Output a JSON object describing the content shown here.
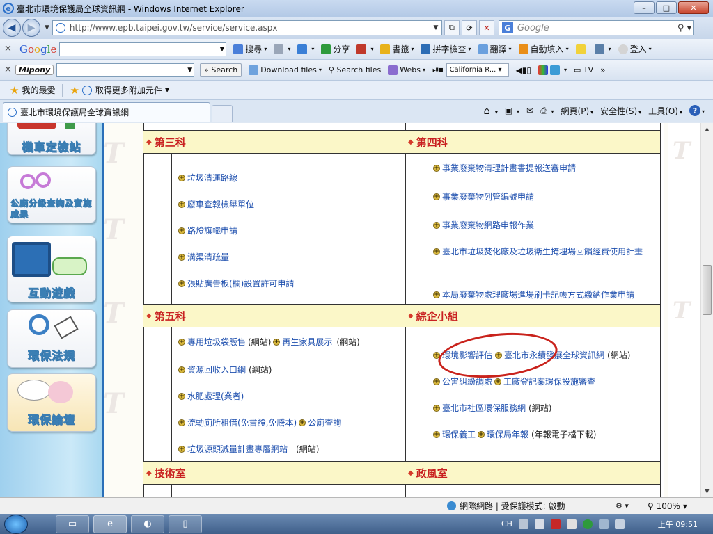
{
  "window": {
    "title": "臺北市環境保護局全球資訊網 - Windows Internet Explorer",
    "min": "–",
    "max": "□",
    "close": "✕"
  },
  "address": {
    "url": "http://www.epb.taipei.gov.tw/service/service.aspx",
    "search_placeholder": "Google"
  },
  "google_toolbar": {
    "logo": [
      "G",
      "o",
      "o",
      "g",
      "l",
      "e"
    ],
    "items": [
      "搜尋",
      "分享",
      "書籤",
      "拼字檢查",
      "翻譯",
      "自動填入",
      "登入"
    ]
  },
  "mipony_toolbar": {
    "logo": "Mipony",
    "search_btn": "Search",
    "download": "Download files",
    "search_files": "Search files",
    "webs": "Webs",
    "radio": "California R...",
    "tv": "TV"
  },
  "favorites": {
    "label": "我的最愛",
    "addons": "取得更多附加元件"
  },
  "tab": {
    "label": "臺北市環境保護局全球資訊網"
  },
  "commandbar": {
    "page": "網頁(P)",
    "safety": "安全性(S)",
    "tools": "工具(O)"
  },
  "leftnav": {
    "items": [
      "機車定檢站",
      "公廁分級查詢及實施成果",
      "互動遊戲",
      "環保法規",
      "環保論壇"
    ]
  },
  "sections": {
    "s3": {
      "title": "第三科",
      "items": [
        "垃圾清運路線",
        "廢車查報檢舉單位",
        "路燈旗幟申請",
        "溝渠清疏量",
        "張貼廣告板(欄)設置許可申請"
      ]
    },
    "s4": {
      "title": "第四科",
      "items": [
        "事業廢棄物清理計畫書提報送審申請",
        "事業廢棄物列管編號申請",
        "事業廢棄物網路申報作業",
        "臺北市垃圾焚化廠及垃圾衛生掩埋場回饋經費使用計畫",
        "本局廢棄物處理廠場進場刷卡記帳方式繳納作業申請"
      ]
    },
    "s5": {
      "title": "第五科",
      "r1a": "專用垃圾袋販售",
      "r1a_note": "(網站)",
      "r1b": "再生家具展示",
      "r1b_note": "(網站)",
      "r2": "資源回收入口網",
      "r2_note": "(網站)",
      "r3": "水肥處理(業者)",
      "r4a": "流動廁所租借(免書證,免謄本)",
      "r4b": "公廁查詢",
      "r5": "垃圾源頭減量計畫專屬網站",
      "r5_note": "(網站)"
    },
    "s6": {
      "title": "綜企小組",
      "r1a": "環境影響評估",
      "r1b": "臺北市永續發展全球資訊網",
      "r1b_note": "(網站)",
      "r2a": "公害糾紛調處",
      "r2b": "工廠登記案環保設施審查",
      "r3": "臺北市社區環保服務網",
      "r3_note": "(網站)",
      "r4a": "環保義工",
      "r4b": "環保局年報",
      "r4b_note": "(年報電子檔下載)"
    },
    "s7": {
      "title": "技術室"
    },
    "s8": {
      "title": "政風室"
    }
  },
  "status": {
    "zone": "網際網路 | 受保護模式: 啟動",
    "zoom": "100%"
  },
  "taskbar": {
    "lang": "CH",
    "clock": "上午 09:51"
  }
}
